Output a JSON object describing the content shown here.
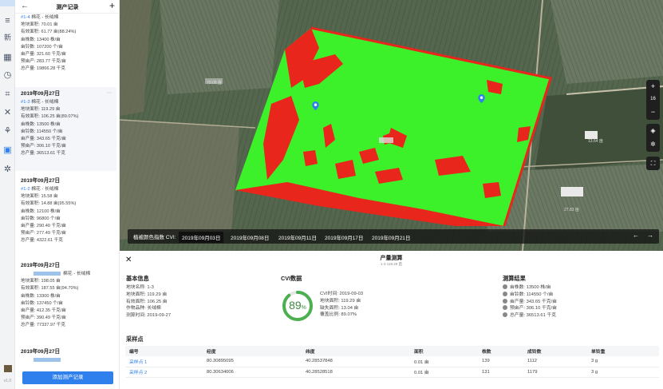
{
  "rail": {
    "icons": [
      "menu-icon",
      "new-icon",
      "calendar-icon",
      "clock-icon",
      "crop-icon",
      "tools-icon",
      "leaf-icon",
      "briefcase-icon",
      "settings-icon"
    ],
    "new_label": "新",
    "footer": "v1.0"
  },
  "panel": {
    "title": "测产记录",
    "records": [
      {
        "date": "",
        "id": "#1-4",
        "name": "棉花 - 长绒棉",
        "lines": [
          "地块面积: 70.01 亩",
          "有效面积: 61.77 亩(88.24%)",
          "亩株数: 13400 株/亩",
          "亩铃数: 107200 个/亩",
          "亩产量: 321.60 千克/亩",
          "预亩产: 283.77 千克/亩",
          "总产量: 19866.28 千克"
        ]
      },
      {
        "date": "2019年09月27日",
        "id": "#1-3",
        "name": "棉花 - 长绒棉",
        "lines": [
          "地块面积: 119.29 亩",
          "有效面积: 106.25 亩(89.07%)",
          "亩株数: 13500 株/亩",
          "亩铃数: 114550 个/亩",
          "亩产量: 343.65 千克/亩",
          "预亩产: 306.10 千克/亩",
          "总产量: 36513.61 千克"
        ]
      },
      {
        "date": "2019年09月27日",
        "id": "#1-2",
        "name": "棉花 - 长绒棉",
        "lines": [
          "地块面积: 15.58 亩",
          "有效面积: 14.88 亩(95.55%)",
          "亩株数: 12100 株/亩",
          "亩铃数: 96800 个/亩",
          "亩产量: 290.40 千克/亩",
          "预亩产: 277.49 千克/亩",
          "总产量: 4322.61 千克"
        ]
      },
      {
        "date": "2019年09月27日",
        "id": "",
        "name": "棉花 - 长绒棉",
        "lines": [
          "地块面积: 198.05 亩",
          "有效面积: 187.55 亩(94.70%)",
          "亩株数: 13300 株/亩",
          "亩铃数: 137450 个/亩",
          "亩产量: 412.35 千克/亩",
          "预亩产: 390.49 千克/亩",
          "总产量: 77337.97 千克"
        ]
      },
      {
        "date": "2019年09月27日",
        "id": "",
        "name": "",
        "lines": []
      }
    ],
    "add_button": "添加测产记录"
  },
  "map": {
    "field_labels": [
      "70.08 亩",
      "13.64 亩",
      "27.83 亩"
    ],
    "zoom_level": "16",
    "zoom_in": "+",
    "zoom_out": "−",
    "timeline": {
      "label": "植被颜色指数 CVI:",
      "dates": [
        "2019年09月03日",
        "2019年09月08日",
        "2019年09月11日",
        "2019年09月17日",
        "2019年09月21日"
      ],
      "active_index": 0,
      "prev": "←",
      "next": "→"
    }
  },
  "detail": {
    "close": "✕",
    "title": "产量测算",
    "subtitle": "1-3 119.29 亩",
    "basic": {
      "heading": "基本信息",
      "lines": [
        "地块名称: 1-3",
        "地块面积: 119.29 亩",
        "有效面积: 106.25 亩",
        "作物品种: 长绒棉",
        "测算时间: 2019-09-27"
      ]
    },
    "cvi": {
      "heading": "CVI数据",
      "percent": 89,
      "percent_text": "89",
      "percent_unit": "%",
      "lines": [
        "CVI时间: 2019-09-03",
        "地块面积: 119.29 亩",
        "缺失面积: 13.04 亩",
        "覆盖比例: 89.07%"
      ]
    },
    "result": {
      "heading": "测算结果",
      "lines": [
        "亩株数: 13500 株/亩",
        "亩铃数: 114550 个/亩",
        "亩产量: 343.65 千克/亩",
        "预亩产: 306.10 千克/亩",
        "总产量: 36513.61 千克"
      ]
    },
    "samples": {
      "heading": "采样点",
      "columns": [
        "编号",
        "经度",
        "纬度",
        "面积",
        "株数",
        "成铃数",
        "单铃重"
      ],
      "rows": [
        [
          "采样点 1",
          "80.30895095",
          "40.28537848",
          "0.01 亩",
          "139",
          "1112",
          "3 g"
        ],
        [
          "采样点 2",
          "80.30634006",
          "40.28528518",
          "0.01 亩",
          "131",
          "1179",
          "3 g"
        ]
      ]
    }
  },
  "colors": {
    "accent": "#2f80ed",
    "healthy": "#3cf02a",
    "stress": "#e8261c",
    "gauge": "#4caf50"
  }
}
